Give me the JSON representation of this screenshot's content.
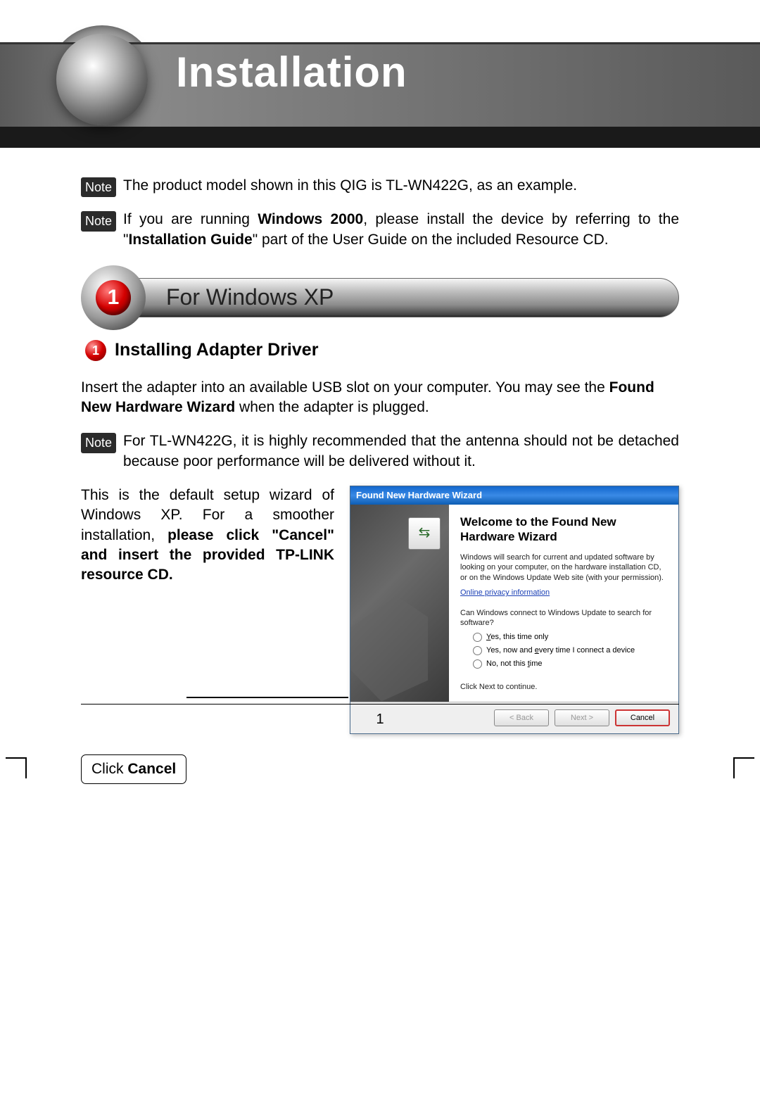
{
  "header": {
    "title": "Installation"
  },
  "notes": {
    "label": "Note",
    "n1": "The product model shown in this QIG is TL-WN422G, as an example.",
    "n2_p1": "If you are running ",
    "n2_b1": "Windows 2000",
    "n2_p2": ", please install the device by referring to the \"",
    "n2_b2": "Installation Guide",
    "n2_p3": "\" part of the User Guide on the included Resource CD.",
    "n3": "For TL-WN422G, it is highly recommended that the antenna should not be detached because poor performance will be delivered without it."
  },
  "section": {
    "number": "1",
    "title": "For Windows XP"
  },
  "subhead": {
    "number": "1",
    "title": "Installing Adapter Driver"
  },
  "body": {
    "p1_a": "Insert the adapter into an available USB slot on your computer. You may see the ",
    "p1_b": "Found New Hardware Wizard",
    "p1_c": " when the adapter is plugged.",
    "left_a": "This is the default setup wizard of Windows XP. For a smoother installation, ",
    "left_b": "please click \"Cancel\" and insert the provided TP-LINK resource CD.",
    "callout_a": "Click ",
    "callout_b": "Cancel"
  },
  "wizard": {
    "title": "Found New Hardware Wizard",
    "heading": "Welcome to the Found New Hardware Wizard",
    "desc": "Windows will search for current and updated software by looking on your computer, on the hardware installation CD, or on the Windows Update Web site (with your permission).",
    "link": "Online privacy information",
    "q": "Can Windows connect to Windows Update to search for software?",
    "r1_pre": "",
    "r1_u": "Y",
    "r1_post": "es, this time only",
    "r2_pre": "Yes, now and ",
    "r2_u": "e",
    "r2_post": "very time I connect a device",
    "r3_pre": "No, not this ",
    "r3_u": "t",
    "r3_post": "ime",
    "cont": "Click Next to continue.",
    "btn_back": "< Back",
    "btn_next": "Next >",
    "btn_cancel": "Cancel"
  },
  "page_number": "1"
}
